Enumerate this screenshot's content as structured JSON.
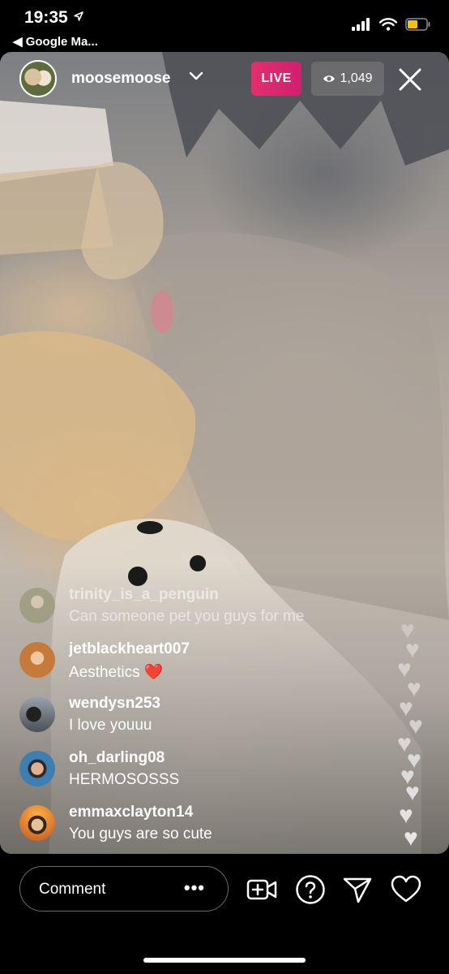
{
  "status_bar": {
    "time": "19:35",
    "back_app": "◀ Google Ma..."
  },
  "header": {
    "host_username": "moosemoose",
    "live_label": "LIVE",
    "viewer_count": "1,049"
  },
  "comments": [
    {
      "username": "trinity_is_a_penguin",
      "text": "Can someone pet you guys for me",
      "avatar_color": "#8a8f6a"
    },
    {
      "username": "jetblackheart007",
      "text": "Aesthetics ❤️",
      "avatar_color": "#c57a3a"
    },
    {
      "username": "wendysn253",
      "text": "I love youuu",
      "avatar_color": "#4a4f55"
    },
    {
      "username": "oh_darling08",
      "text": "HERMOSOSSS",
      "avatar_color": "#3d7fb0"
    },
    {
      "username": "emmaxclayton14",
      "text": "You guys are so cute",
      "avatar_color": "#c0541e"
    }
  ],
  "bottom_bar": {
    "comment_placeholder": "Comment",
    "more_label": "•••",
    "icons": [
      "add-video-icon",
      "question-icon",
      "send-icon",
      "heart-icon"
    ]
  },
  "colors": {
    "live_badge": "#e1306c",
    "background": "#000000"
  }
}
